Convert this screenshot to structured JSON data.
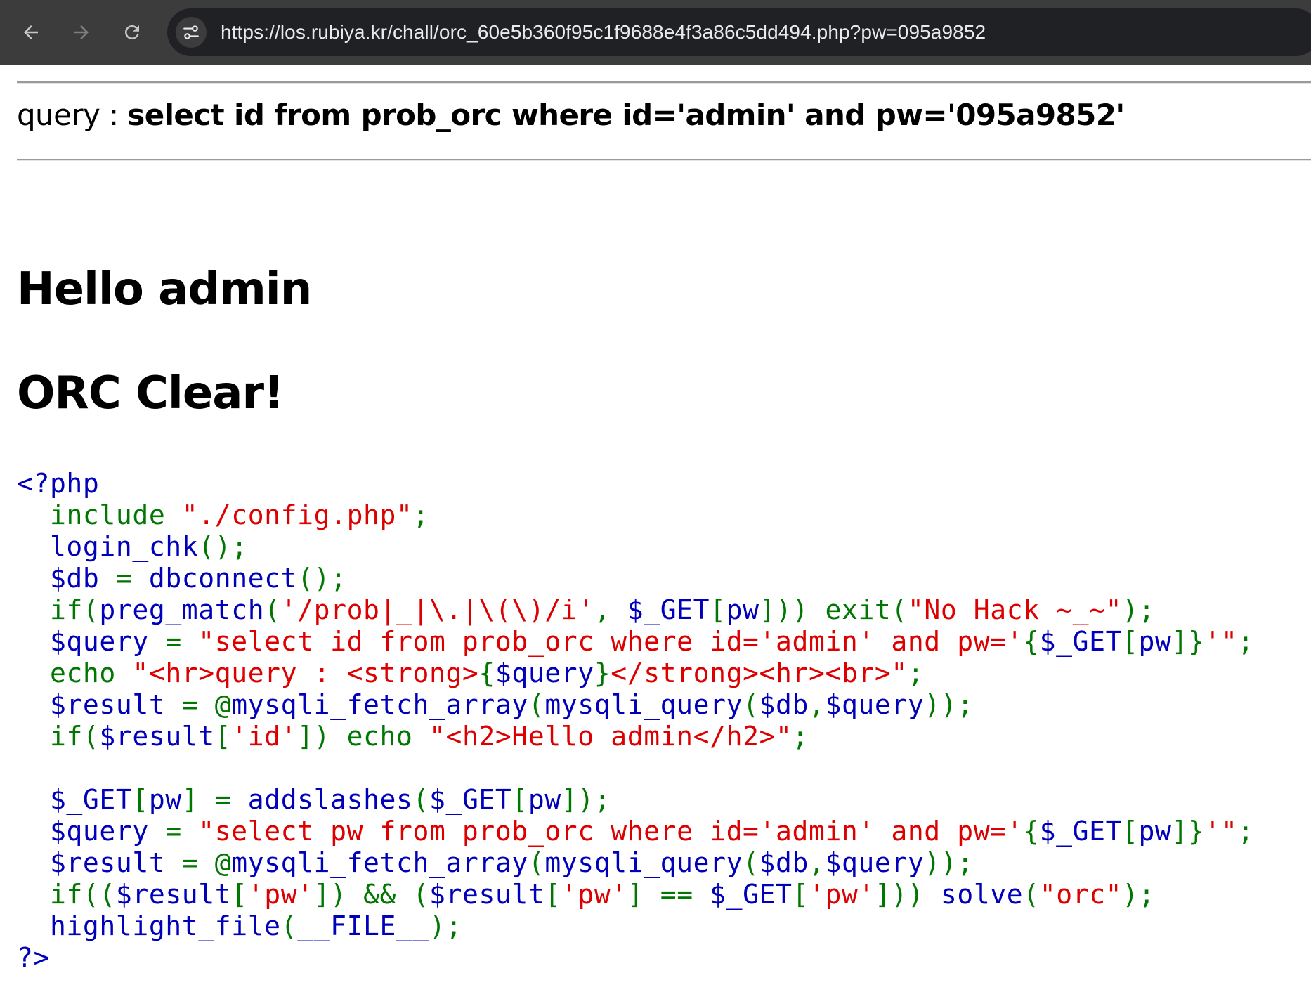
{
  "browser": {
    "url": "https://los.rubiya.kr/chall/orc_60e5b360f95c1f9688e4f3a86c5dd494.php?pw=095a9852",
    "icons": [
      "back-arrow-icon",
      "forward-arrow-icon",
      "reload-icon",
      "site-info-icon"
    ]
  },
  "page": {
    "query_label": "query : ",
    "query_value": "select id from prob_orc where id='admin' and pw='095a9852'",
    "heading_hello": "Hello admin",
    "heading_clear": "ORC Clear!"
  },
  "colors": {
    "toolbar_bg": "#3c3c3c",
    "omnibox_bg": "#202124",
    "php_default": "#0000bb",
    "php_keyword": "#007700",
    "php_string": "#dd0000"
  },
  "source_code": [
    [
      {
        "t": "d",
        "s": "<?php"
      }
    ],
    [
      {
        "t": "d",
        "s": "  "
      },
      {
        "t": "k",
        "s": "include "
      },
      {
        "t": "s",
        "s": "\"./config.php\""
      },
      {
        "t": "k",
        "s": ";"
      }
    ],
    [
      {
        "t": "d",
        "s": "  login_chk"
      },
      {
        "t": "k",
        "s": "();"
      }
    ],
    [
      {
        "t": "d",
        "s": "  $db "
      },
      {
        "t": "k",
        "s": "= "
      },
      {
        "t": "d",
        "s": "dbconnect"
      },
      {
        "t": "k",
        "s": "();"
      }
    ],
    [
      {
        "t": "d",
        "s": "  "
      },
      {
        "t": "k",
        "s": "if("
      },
      {
        "t": "d",
        "s": "preg_match"
      },
      {
        "t": "k",
        "s": "("
      },
      {
        "t": "s",
        "s": "'/prob|_|\\.|\\(\\)/i'"
      },
      {
        "t": "k",
        "s": ", "
      },
      {
        "t": "d",
        "s": "$_GET"
      },
      {
        "t": "k",
        "s": "["
      },
      {
        "t": "d",
        "s": "pw"
      },
      {
        "t": "k",
        "s": "])) exit("
      },
      {
        "t": "s",
        "s": "\"No Hack ~_~\""
      },
      {
        "t": "k",
        "s": ");"
      }
    ],
    [
      {
        "t": "d",
        "s": "  $query "
      },
      {
        "t": "k",
        "s": "= "
      },
      {
        "t": "s",
        "s": "\"select id from prob_orc where id='admin' and pw='"
      },
      {
        "t": "k",
        "s": "{"
      },
      {
        "t": "d",
        "s": "$_GET"
      },
      {
        "t": "k",
        "s": "["
      },
      {
        "t": "d",
        "s": "pw"
      },
      {
        "t": "k",
        "s": "]}"
      },
      {
        "t": "s",
        "s": "'\""
      },
      {
        "t": "k",
        "s": ";"
      }
    ],
    [
      {
        "t": "d",
        "s": "  "
      },
      {
        "t": "k",
        "s": "echo "
      },
      {
        "t": "s",
        "s": "\"<hr>query : <strong>"
      },
      {
        "t": "k",
        "s": "{"
      },
      {
        "t": "d",
        "s": "$query"
      },
      {
        "t": "k",
        "s": "}"
      },
      {
        "t": "s",
        "s": "</strong><hr><br>\""
      },
      {
        "t": "k",
        "s": ";"
      }
    ],
    [
      {
        "t": "d",
        "s": "  $result "
      },
      {
        "t": "k",
        "s": "= @"
      },
      {
        "t": "d",
        "s": "mysqli_fetch_array"
      },
      {
        "t": "k",
        "s": "("
      },
      {
        "t": "d",
        "s": "mysqli_query"
      },
      {
        "t": "k",
        "s": "("
      },
      {
        "t": "d",
        "s": "$db"
      },
      {
        "t": "k",
        "s": ","
      },
      {
        "t": "d",
        "s": "$query"
      },
      {
        "t": "k",
        "s": "));"
      }
    ],
    [
      {
        "t": "d",
        "s": "  "
      },
      {
        "t": "k",
        "s": "if("
      },
      {
        "t": "d",
        "s": "$result"
      },
      {
        "t": "k",
        "s": "["
      },
      {
        "t": "s",
        "s": "'id'"
      },
      {
        "t": "k",
        "s": "]) echo "
      },
      {
        "t": "s",
        "s": "\"<h2>Hello admin</h2>\""
      },
      {
        "t": "k",
        "s": ";"
      }
    ],
    [
      {
        "t": "d",
        "s": ""
      }
    ],
    [
      {
        "t": "d",
        "s": "  $_GET"
      },
      {
        "t": "k",
        "s": "["
      },
      {
        "t": "d",
        "s": "pw"
      },
      {
        "t": "k",
        "s": "] = "
      },
      {
        "t": "d",
        "s": "addslashes"
      },
      {
        "t": "k",
        "s": "("
      },
      {
        "t": "d",
        "s": "$_GET"
      },
      {
        "t": "k",
        "s": "["
      },
      {
        "t": "d",
        "s": "pw"
      },
      {
        "t": "k",
        "s": "]);"
      }
    ],
    [
      {
        "t": "d",
        "s": "  $query "
      },
      {
        "t": "k",
        "s": "= "
      },
      {
        "t": "s",
        "s": "\"select pw from prob_orc where id='admin' and pw='"
      },
      {
        "t": "k",
        "s": "{"
      },
      {
        "t": "d",
        "s": "$_GET"
      },
      {
        "t": "k",
        "s": "["
      },
      {
        "t": "d",
        "s": "pw"
      },
      {
        "t": "k",
        "s": "]}"
      },
      {
        "t": "s",
        "s": "'\""
      },
      {
        "t": "k",
        "s": ";"
      }
    ],
    [
      {
        "t": "d",
        "s": "  $result "
      },
      {
        "t": "k",
        "s": "= @"
      },
      {
        "t": "d",
        "s": "mysqli_fetch_array"
      },
      {
        "t": "k",
        "s": "("
      },
      {
        "t": "d",
        "s": "mysqli_query"
      },
      {
        "t": "k",
        "s": "("
      },
      {
        "t": "d",
        "s": "$db"
      },
      {
        "t": "k",
        "s": ","
      },
      {
        "t": "d",
        "s": "$query"
      },
      {
        "t": "k",
        "s": "));"
      }
    ],
    [
      {
        "t": "d",
        "s": "  "
      },
      {
        "t": "k",
        "s": "if(("
      },
      {
        "t": "d",
        "s": "$result"
      },
      {
        "t": "k",
        "s": "["
      },
      {
        "t": "s",
        "s": "'pw'"
      },
      {
        "t": "k",
        "s": "]) && ("
      },
      {
        "t": "d",
        "s": "$result"
      },
      {
        "t": "k",
        "s": "["
      },
      {
        "t": "s",
        "s": "'pw'"
      },
      {
        "t": "k",
        "s": "] == "
      },
      {
        "t": "d",
        "s": "$_GET"
      },
      {
        "t": "k",
        "s": "["
      },
      {
        "t": "s",
        "s": "'pw'"
      },
      {
        "t": "k",
        "s": "])) "
      },
      {
        "t": "d",
        "s": "solve"
      },
      {
        "t": "k",
        "s": "("
      },
      {
        "t": "s",
        "s": "\"orc\""
      },
      {
        "t": "k",
        "s": ");"
      }
    ],
    [
      {
        "t": "d",
        "s": "  highlight_file"
      },
      {
        "t": "k",
        "s": "("
      },
      {
        "t": "d",
        "s": "__FILE__"
      },
      {
        "t": "k",
        "s": ");"
      }
    ],
    [
      {
        "t": "d",
        "s": "?>"
      }
    ]
  ]
}
